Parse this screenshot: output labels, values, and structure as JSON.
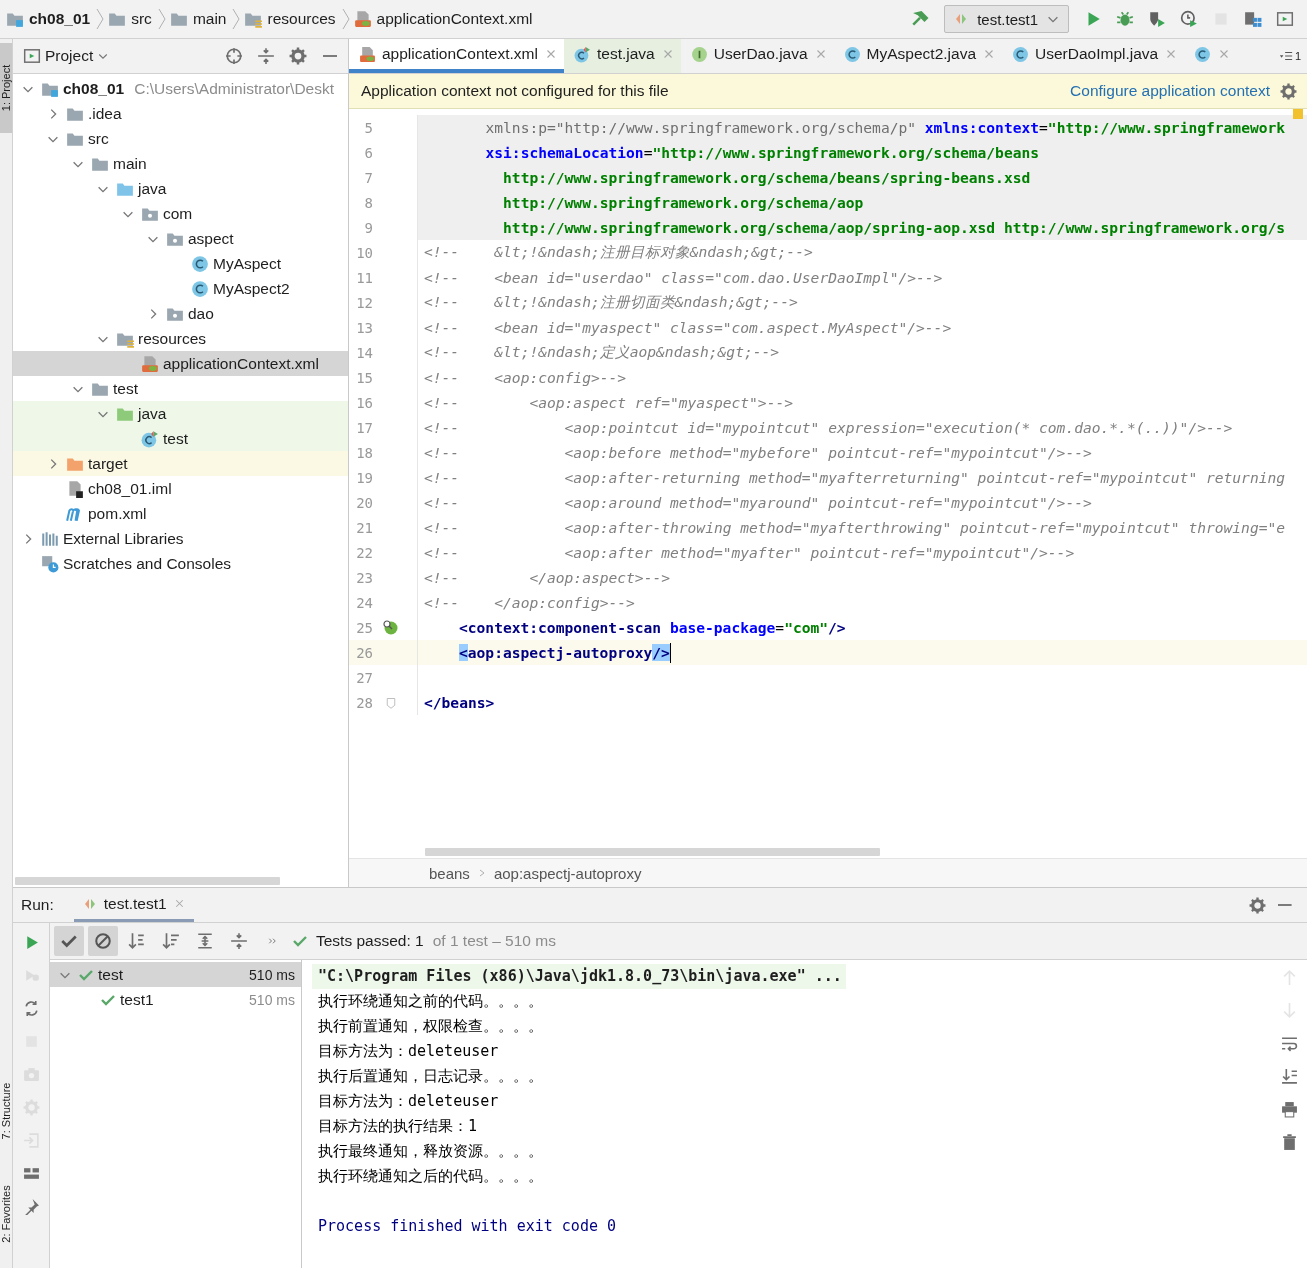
{
  "navbar": {
    "breadcrumbs": [
      {
        "label": "ch08_01",
        "kind": "module"
      },
      {
        "label": "src",
        "kind": "folder"
      },
      {
        "label": "main",
        "kind": "folder"
      },
      {
        "label": "resources",
        "kind": "resources"
      },
      {
        "label": "applicationContext.xml",
        "kind": "xml"
      }
    ],
    "run_config": "test.test1",
    "actions": [
      {
        "kind": "build",
        "disabled": false
      },
      {
        "kind": "config"
      },
      {
        "kind": "run",
        "disabled": false
      },
      {
        "kind": "debug",
        "disabled": false
      },
      {
        "kind": "coverage",
        "disabled": false
      },
      {
        "kind": "profile",
        "disabled": false
      },
      {
        "kind": "stop",
        "disabled": true
      },
      {
        "kind": "project-structure",
        "disabled": false
      },
      {
        "kind": "toolwindow",
        "disabled": false
      }
    ]
  },
  "side_strip": [
    {
      "label": "1: Project",
      "selected": true
    },
    {
      "label": "7: Structure",
      "selected": false
    },
    {
      "label": "2: Favorites",
      "selected": false
    }
  ],
  "project": {
    "title": "Project",
    "tree": [
      {
        "label": "ch08_01",
        "path": "C:\\Users\\Administrator\\Deskt",
        "kind": "module",
        "selected": false,
        "expanded": true,
        "children": [
          {
            "label": ".idea",
            "kind": "folder",
            "selected": false,
            "expanded": false
          },
          {
            "label": "src",
            "kind": "folder",
            "selected": false,
            "expanded": true,
            "children": [
              {
                "label": "main",
                "kind": "folder",
                "selected": false,
                "expanded": true,
                "children": [
                  {
                    "label": "java",
                    "kind": "source-folder",
                    "selected": false,
                    "expanded": true,
                    "children": [
                      {
                        "label": "com",
                        "kind": "package",
                        "selected": false,
                        "expanded": true,
                        "children": [
                          {
                            "label": "aspect",
                            "kind": "package",
                            "selected": false,
                            "expanded": true,
                            "children": [
                              {
                                "label": "MyAspect",
                                "kind": "class",
                                "selected": false
                              },
                              {
                                "label": "MyAspect2",
                                "kind": "class",
                                "selected": false
                              }
                            ]
                          },
                          {
                            "label": "dao",
                            "kind": "package",
                            "selected": false,
                            "expanded": false
                          }
                        ]
                      }
                    ]
                  },
                  {
                    "label": "resources",
                    "kind": "resources",
                    "selected": false,
                    "expanded": true,
                    "children": [
                      {
                        "label": "applicationContext.xml",
                        "kind": "xml",
                        "selected": true
                      }
                    ]
                  }
                ]
              },
              {
                "label": "test",
                "kind": "folder",
                "selected": false,
                "expanded": true,
                "children": [
                  {
                    "label": "java",
                    "kind": "test-folder",
                    "selected": false,
                    "expanded": true,
                    "children": [
                      {
                        "label": "test",
                        "kind": "test-class",
                        "selected": false
                      }
                    ]
                  }
                ]
              }
            ]
          },
          {
            "label": "target",
            "kind": "excluded-folder",
            "selected": false,
            "expanded": false
          },
          {
            "label": "ch08_01.iml",
            "kind": "iml",
            "selected": false
          },
          {
            "label": "pom.xml",
            "kind": "maven",
            "selected": false
          }
        ]
      },
      {
        "label": "External Libraries",
        "kind": "libraries",
        "selected": false,
        "expanded": false
      },
      {
        "label": "Scratches and Consoles",
        "kind": "scratches",
        "selected": false
      }
    ]
  },
  "editor": {
    "tabs": [
      {
        "label": "applicationContext.xml",
        "kind": "xml",
        "selected": true
      },
      {
        "label": "test.java",
        "kind": "test-class",
        "selected": false
      },
      {
        "label": "UserDao.java",
        "kind": "interface",
        "selected": false
      },
      {
        "label": "MyAspect2.java",
        "kind": "class",
        "selected": false
      },
      {
        "label": "UserDaoImpl.java",
        "kind": "class",
        "selected": false
      },
      {
        "kind": "class",
        "selected": false
      }
    ],
    "tab_count": "1",
    "notification": {
      "message": "Application context not configured for this file",
      "link": "Configure application context"
    },
    "lines": [
      {
        "number": "5",
        "kind": "header",
        "segments": [
          {
            "kind": "unused",
            "text": "       xmlns:p=\"http://www.springframework.org/schema/p\""
          },
          {
            "kind": "attr",
            "text": " xmlns:context"
          },
          {
            "kind": "plain",
            "text": "="
          },
          {
            "kind": "value",
            "text": "\"http://www.springframework"
          }
        ]
      },
      {
        "number": "6",
        "kind": "header",
        "segments": [
          {
            "kind": "attr",
            "text": "       xsi:schemaLocation"
          },
          {
            "kind": "plain",
            "text": "="
          },
          {
            "kind": "value",
            "text": "\"http://www.springframework.org/schema/beans"
          }
        ]
      },
      {
        "number": "7",
        "kind": "header",
        "segments": [
          {
            "kind": "value",
            "text": "         http://www.springframework.org/schema/beans/spring-beans.xsd"
          }
        ]
      },
      {
        "number": "8",
        "kind": "header",
        "segments": [
          {
            "kind": "value",
            "text": "         http://www.springframework.org/schema/aop"
          }
        ]
      },
      {
        "number": "9",
        "kind": "header",
        "segments": [
          {
            "kind": "value",
            "text": "         http://www.springframework.org/schema/aop/spring-aop.xsd http://www.springframework.org/s"
          }
        ]
      },
      {
        "number": "10",
        "kind": "normal",
        "segments": [
          {
            "kind": "comment",
            "text": "<!--    &lt;!&ndash;注册目标对象&ndash;&gt;-->"
          }
        ]
      },
      {
        "number": "11",
        "kind": "normal",
        "segments": [
          {
            "kind": "comment",
            "text": "<!--    <bean id=\"userdao\" class=\"com.dao.UserDaoImpl\"/>-->"
          }
        ]
      },
      {
        "number": "12",
        "kind": "normal",
        "segments": [
          {
            "kind": "comment",
            "text": "<!--    &lt;!&ndash;注册切面类&ndash;&gt;-->"
          }
        ]
      },
      {
        "number": "13",
        "kind": "normal",
        "segments": [
          {
            "kind": "comment",
            "text": "<!--    <bean id=\"myaspect\" class=\"com.aspect.MyAspect\"/>-->"
          }
        ]
      },
      {
        "number": "14",
        "kind": "normal",
        "segments": [
          {
            "kind": "comment",
            "text": "<!--    &lt;!&ndash;定义aop&ndash;&gt;-->"
          }
        ]
      },
      {
        "number": "15",
        "kind": "normal",
        "segments": [
          {
            "kind": "comment",
            "text": "<!--    <aop:config>-->"
          }
        ]
      },
      {
        "number": "16",
        "kind": "normal",
        "segments": [
          {
            "kind": "comment",
            "text": "<!--        <aop:aspect ref=\"myaspect\">-->"
          }
        ]
      },
      {
        "number": "17",
        "kind": "normal",
        "segments": [
          {
            "kind": "comment",
            "text": "<!--            <aop:pointcut id=\"mypointcut\" expression=\"execution(* com.dao.*.*(..))\"/>-->"
          }
        ]
      },
      {
        "number": "18",
        "kind": "normal",
        "segments": [
          {
            "kind": "comment",
            "text": "<!--            <aop:before method=\"mybefore\" pointcut-ref=\"mypointcut\"/>-->"
          }
        ]
      },
      {
        "number": "19",
        "kind": "normal",
        "segments": [
          {
            "kind": "comment",
            "text": "<!--            <aop:after-returning method=\"myafterreturning\" pointcut-ref=\"mypointcut\" returning"
          }
        ]
      },
      {
        "number": "20",
        "kind": "normal",
        "segments": [
          {
            "kind": "comment",
            "text": "<!--            <aop:around method=\"myaround\" pointcut-ref=\"mypointcut\"/>-->"
          }
        ]
      },
      {
        "number": "21",
        "kind": "normal",
        "segments": [
          {
            "kind": "comment",
            "text": "<!--            <aop:after-throwing method=\"myafterthrowing\" pointcut-ref=\"mypointcut\" throwing=\"e"
          }
        ]
      },
      {
        "number": "22",
        "kind": "normal",
        "segments": [
          {
            "kind": "comment",
            "text": "<!--            <aop:after method=\"myafter\" pointcut-ref=\"mypointcut\"/>-->"
          }
        ]
      },
      {
        "number": "23",
        "kind": "normal",
        "segments": [
          {
            "kind": "comment",
            "text": "<!--        </aop:aspect>-->"
          }
        ]
      },
      {
        "number": "24",
        "kind": "normal",
        "segments": [
          {
            "kind": "comment",
            "text": "<!--    </aop:config>-->"
          }
        ]
      },
      {
        "number": "25",
        "kind": "bean",
        "segments": [
          {
            "kind": "tag",
            "text": "<context:component-scan"
          },
          {
            "kind": "attr",
            "text": " base-package"
          },
          {
            "kind": "plain",
            "text": "="
          },
          {
            "kind": "value",
            "text": "\"com\""
          },
          {
            "kind": "tag",
            "text": "/>"
          }
        ]
      },
      {
        "number": "26",
        "kind": "current",
        "segments": [
          {
            "kind": "match",
            "text": "<"
          },
          {
            "kind": "tag",
            "text": "aop:aspectj-autoproxy"
          },
          {
            "kind": "match",
            "text": "/>"
          }
        ]
      },
      {
        "number": "27",
        "kind": "normal"
      },
      {
        "number": "28",
        "kind": "fold",
        "segments": [
          {
            "kind": "tag",
            "text": "</beans>"
          }
        ]
      }
    ],
    "breadcrumbs": [
      "beans",
      "aop:aspectj-autoproxy"
    ]
  },
  "run": {
    "label": "Run:",
    "tab": {
      "label": "test.test1",
      "selected": true
    },
    "side_actions": [
      {
        "kind": "rerun",
        "disabled": false
      },
      {
        "kind": "rerun-failed",
        "disabled": true
      },
      {
        "kind": "toggle-auto",
        "disabled": false
      },
      {
        "kind": "stop",
        "disabled": true
      },
      {
        "kind": "screenshot",
        "disabled": true
      },
      {
        "kind": "settings",
        "disabled": true
      },
      {
        "kind": "import",
        "disabled": true
      },
      {
        "kind": "layout",
        "disabled": false
      },
      {
        "kind": "pin",
        "disabled": false
      }
    ],
    "toolbar": [
      {
        "kind": "show-passed",
        "selected": true
      },
      {
        "kind": "show-ignored",
        "selected": true
      },
      {
        "kind": "sort-alpha",
        "selected": false
      },
      {
        "kind": "sort-duration",
        "selected": false
      },
      {
        "kind": "expand-all",
        "selected": false
      },
      {
        "kind": "collapse-all",
        "selected": false
      },
      {
        "kind": "more",
        "selected": false
      }
    ],
    "status": {
      "passed": "Tests passed: 1",
      "detail": "of 1 test – 510 ms"
    },
    "tests": [
      {
        "label": "test",
        "duration": "510 ms",
        "passed": true,
        "selected": true,
        "expanded": true,
        "children": [
          {
            "label": "test1",
            "duration": "510 ms",
            "passed": true,
            "selected": false
          }
        ]
      }
    ],
    "console": [
      {
        "kind": "command",
        "text": "\"C:\\Program Files (x86)\\Java\\jdk1.8.0_73\\bin\\java.exe\" ..."
      },
      {
        "kind": "output",
        "text": "执行环绕通知之前的代码。。。。"
      },
      {
        "kind": "output",
        "text": "执行前置通知，权限检查。。。。"
      },
      {
        "kind": "output",
        "text": "目标方法为：deleteuser"
      },
      {
        "kind": "output",
        "text": "执行后置通知，日志记录。。。。"
      },
      {
        "kind": "output",
        "text": "目标方法为：deleteuser"
      },
      {
        "kind": "output",
        "text": "目标方法的执行结果：1"
      },
      {
        "kind": "output",
        "text": "执行最终通知，释放资源。。。。"
      },
      {
        "kind": "output",
        "text": "执行环绕通知之后的代码。。。。"
      },
      {
        "kind": "process",
        "text": "Process finished with exit code 0"
      }
    ],
    "console_actions": [
      {
        "kind": "up",
        "disabled": true
      },
      {
        "kind": "down",
        "disabled": true
      },
      {
        "kind": "soft-wrap",
        "disabled": false
      },
      {
        "kind": "scroll-end",
        "disabled": false
      },
      {
        "kind": "print",
        "disabled": false
      },
      {
        "kind": "clear",
        "disabled": false
      }
    ]
  }
}
